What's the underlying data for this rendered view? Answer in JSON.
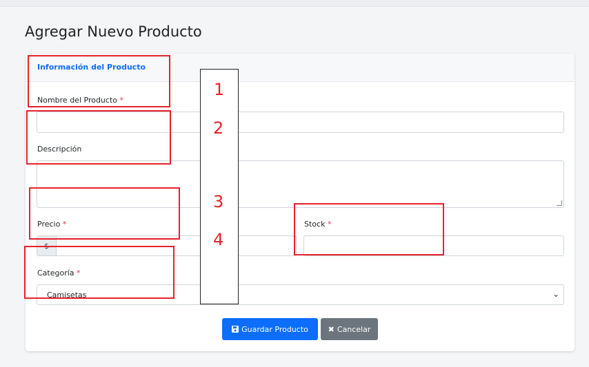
{
  "page": {
    "title": "Agregar Nuevo Producto"
  },
  "card": {
    "header": "Información del Producto"
  },
  "form": {
    "required_mark": "*",
    "name": {
      "label": "Nombre del Producto",
      "value": ""
    },
    "description": {
      "label": "Descripción",
      "value": ""
    },
    "price": {
      "label": "Precio",
      "addon": "$",
      "value": ""
    },
    "stock": {
      "label": "Stock",
      "value": ""
    },
    "category": {
      "label": "Categoría",
      "selected": "Camisetas"
    }
  },
  "actions": {
    "save_label": "Guardar Producto",
    "cancel_label": "Cancelar",
    "save_icon": "save-icon",
    "cancel_icon": "x-icon"
  },
  "annotations": {
    "numbers": [
      "1",
      "2",
      "3",
      "4"
    ],
    "color": "#e8202a"
  },
  "colors": {
    "primary": "#0d6efd",
    "secondary": "#6c757d",
    "required": "#dc3545"
  }
}
